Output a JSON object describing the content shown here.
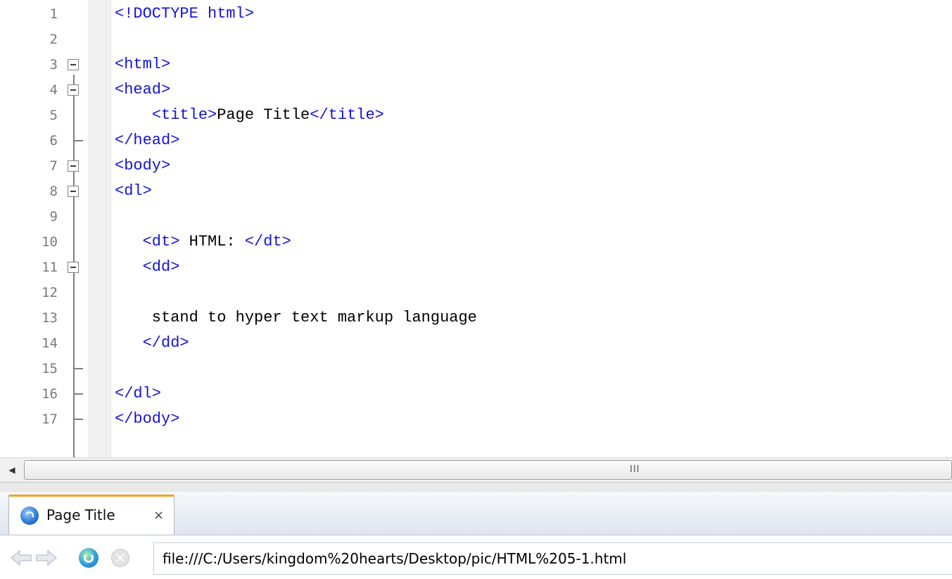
{
  "editor": {
    "lines": [
      {
        "num": "1",
        "parts": [
          {
            "t": "tag",
            "v": "<!DOCTYPE html>"
          }
        ]
      },
      {
        "num": "2",
        "parts": []
      },
      {
        "num": "3",
        "parts": [
          {
            "t": "tag",
            "v": "<html>"
          }
        ]
      },
      {
        "num": "4",
        "parts": [
          {
            "t": "tag",
            "v": "<head>"
          }
        ]
      },
      {
        "num": "5",
        "parts": [
          {
            "t": "txt",
            "v": "    "
          },
          {
            "t": "tag",
            "v": "<title>"
          },
          {
            "t": "txt",
            "v": "Page Title"
          },
          {
            "t": "tag",
            "v": "</title>"
          }
        ]
      },
      {
        "num": "6",
        "parts": [
          {
            "t": "tag",
            "v": "</head>"
          }
        ]
      },
      {
        "num": "7",
        "parts": [
          {
            "t": "tag",
            "v": "<body>"
          }
        ]
      },
      {
        "num": "8",
        "parts": [
          {
            "t": "tag",
            "v": "<dl>"
          }
        ]
      },
      {
        "num": "9",
        "parts": []
      },
      {
        "num": "10",
        "parts": [
          {
            "t": "txt",
            "v": "   "
          },
          {
            "t": "tag",
            "v": "<dt>"
          },
          {
            "t": "txt",
            "v": " HTML: "
          },
          {
            "t": "tag",
            "v": "</dt>"
          }
        ]
      },
      {
        "num": "11",
        "parts": [
          {
            "t": "txt",
            "v": "   "
          },
          {
            "t": "tag",
            "v": "<dd>"
          }
        ]
      },
      {
        "num": "12",
        "parts": []
      },
      {
        "num": "13",
        "parts": [
          {
            "t": "txt",
            "v": "    stand to hyper text markup language"
          }
        ]
      },
      {
        "num": "14",
        "parts": [
          {
            "t": "txt",
            "v": "   "
          },
          {
            "t": "tag",
            "v": "</dd>"
          }
        ]
      },
      {
        "num": "15",
        "parts": []
      },
      {
        "num": "16",
        "parts": [
          {
            "t": "tag",
            "v": "</dl>"
          }
        ]
      },
      {
        "num": "17",
        "parts": [
          {
            "t": "tag",
            "v": "</body>"
          }
        ]
      }
    ],
    "fold_boxes": [
      "3",
      "4",
      "7",
      "8",
      "11"
    ],
    "fold_ends": [
      "6",
      "15",
      "16",
      "17"
    ],
    "colors": {
      "tag": "#1414d8",
      "text": "#000000",
      "line_number": "#7a7a7a"
    }
  },
  "scrollbar": {
    "left_arrow_icon": "scroll-left-arrow-icon",
    "grip": "III"
  },
  "preview": {
    "tab": {
      "label": "Page Title",
      "close": "×",
      "icon": "browser-globe-icon"
    },
    "nav": {
      "back_icon": "back-arrow-icon",
      "forward_icon": "forward-arrow-icon",
      "refresh_icon": "refresh-icon",
      "stop_icon": "stop-icon"
    },
    "url": "file:///C:/Users/kingdom%20hearts/Desktop/pic/HTML%205-1.html",
    "accent_color": "#f4a11f"
  }
}
